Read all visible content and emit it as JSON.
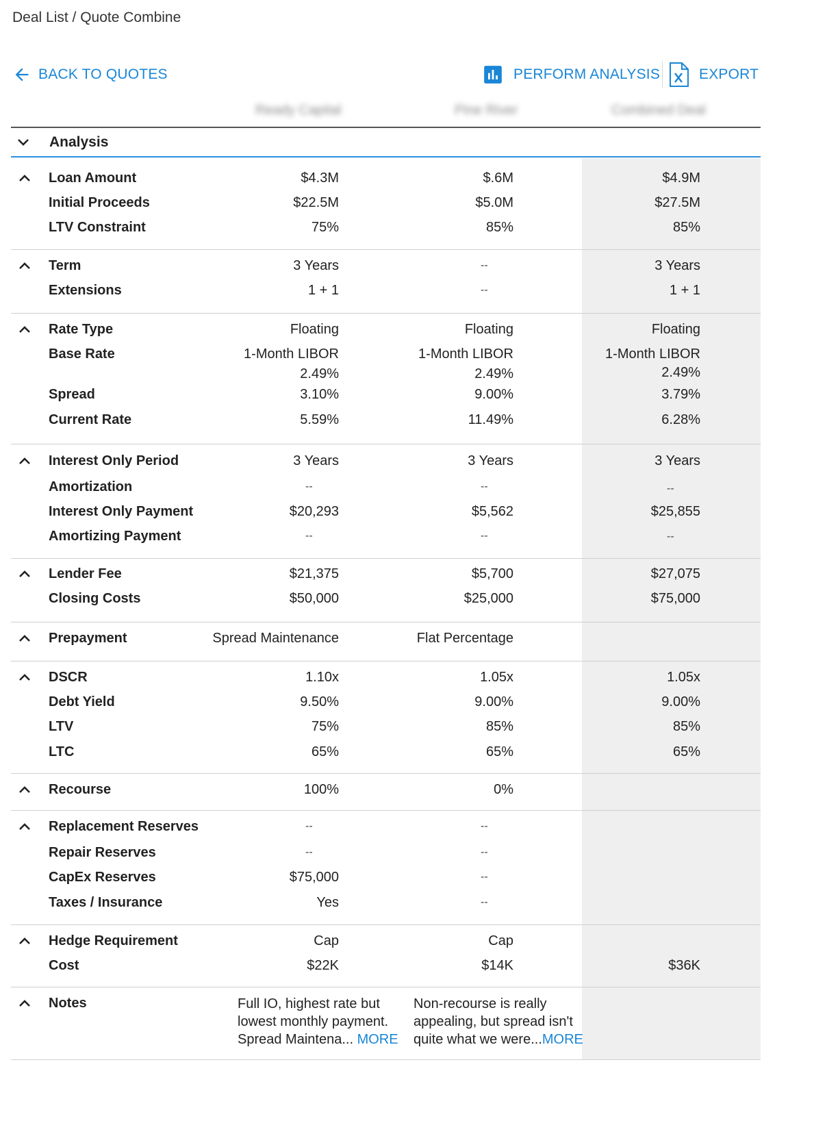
{
  "breadcrumb": "Deal List / Quote Combine",
  "toolbar": {
    "back_label": "BACK TO QUOTES",
    "analysis_label": "PERFORM ANALYSIS",
    "export_label": "EXPORT",
    "accent_color": "#1a86d6"
  },
  "columns": [
    "Ready Capital",
    "Pine River",
    "Combined Deal"
  ],
  "analysis_label": "Analysis",
  "rows": {
    "loan_amount": {
      "label": "Loan Amount",
      "v1": "$4.3M",
      "v2": "$.6M",
      "v3": "$4.9M"
    },
    "initial_proceeds": {
      "label": "Initial Proceeds",
      "v1": "$22.5M",
      "v2": "$5.0M",
      "v3": "$27.5M"
    },
    "ltv_constraint": {
      "label": "LTV Constraint",
      "v1": "75%",
      "v2": "85%",
      "v3": "85%"
    },
    "term": {
      "label": "Term",
      "v1": "3 Years",
      "v2": "--",
      "v3": "3 Years"
    },
    "extensions": {
      "label": "Extensions",
      "v1": "1 + 1",
      "v2": "--",
      "v3": "1 + 1"
    },
    "rate_type": {
      "label": "Rate Type",
      "v1": "Floating",
      "v2": "Floating",
      "v3": "Floating"
    },
    "base_rate": {
      "label": "Base Rate",
      "v1": "1-Month LIBOR",
      "v2": "1-Month LIBOR",
      "v3": "1-Month LIBOR"
    },
    "base_rate_pct": {
      "v1": "2.49%",
      "v2": "2.49%",
      "v3": "2.49%"
    },
    "spread": {
      "label": "Spread",
      "v1": "3.10%",
      "v2": "9.00%",
      "v3": "3.79%"
    },
    "current_rate": {
      "label": "Current Rate",
      "v1": "5.59%",
      "v2": "11.49%",
      "v3": "6.28%"
    },
    "io_period": {
      "label": "Interest Only Period",
      "v1": "3 Years",
      "v2": "3 Years",
      "v3": "3 Years"
    },
    "amortization": {
      "label": "Amortization",
      "v1": "--",
      "v2": "--",
      "v3": "--"
    },
    "io_payment": {
      "label": "Interest Only Payment",
      "v1": "$20,293",
      "v2": "$5,562",
      "v3": "$25,855"
    },
    "amortizing_payment": {
      "label": "Amortizing Payment",
      "v1": "--",
      "v2": "--",
      "v3": "--"
    },
    "lender_fee": {
      "label": "Lender Fee",
      "v1": "$21,375",
      "v2": "$5,700",
      "v3": "$27,075"
    },
    "closing_costs": {
      "label": "Closing Costs",
      "v1": "$50,000",
      "v2": "$25,000",
      "v3": "$75,000"
    },
    "prepayment": {
      "label": "Prepayment",
      "v1": "Spread Maintenance",
      "v2": "Flat Percentage"
    },
    "dscr": {
      "label": "DSCR",
      "v1": "1.10x",
      "v2": "1.05x",
      "v3": "1.05x"
    },
    "debt_yield": {
      "label": "Debt Yield",
      "v1": "9.50%",
      "v2": "9.00%",
      "v3": "9.00%"
    },
    "ltv": {
      "label": "LTV",
      "v1": "75%",
      "v2": "85%",
      "v3": "85%"
    },
    "ltc": {
      "label": "LTC",
      "v1": "65%",
      "v2": "65%",
      "v3": "65%"
    },
    "recourse": {
      "label": "Recourse",
      "v1": "100%",
      "v2": "0%"
    },
    "replacement_reserves": {
      "label": "Replacement Reserves",
      "v1": "--",
      "v2": "--"
    },
    "repair_reserves": {
      "label": "Repair Reserves",
      "v1": "--",
      "v2": "--"
    },
    "capex_reserves": {
      "label": "CapEx Reserves",
      "v1": "$75,000",
      "v2": "--"
    },
    "taxes_insurance": {
      "label": "Taxes / Insurance",
      "v1": "Yes",
      "v2": "--"
    },
    "hedge_requirement": {
      "label": "Hedge Requirement",
      "v1": "Cap",
      "v2": "Cap"
    },
    "cost": {
      "label": "Cost",
      "v1": "$22K",
      "v2": "$14K",
      "v3": "$36K"
    }
  },
  "notes": {
    "label": "Notes",
    "note1": [
      "Full IO, highest rate but",
      "lowest monthly payment.",
      "Spread Maintena... "
    ],
    "note2": [
      "Non-recourse is really",
      "appealing, but spread isn't",
      "quite what we were..."
    ],
    "more_label": "MORE"
  }
}
